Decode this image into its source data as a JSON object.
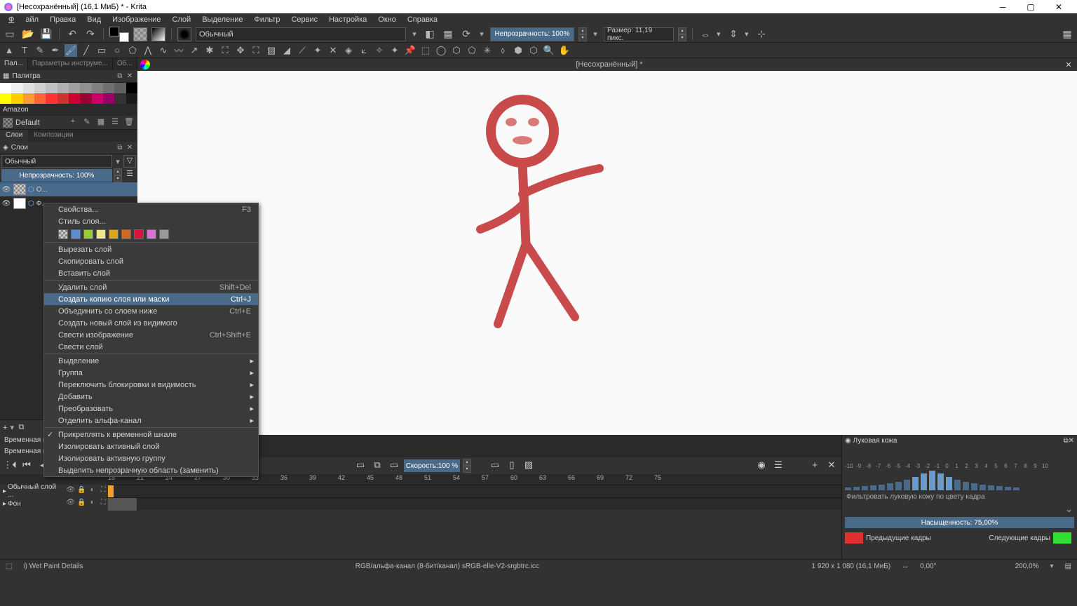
{
  "titlebar": {
    "text": "[Несохранённый] (16,1 МиБ) * - Krita"
  },
  "menu": {
    "file": "Файл",
    "edit": "Правка",
    "view": "Вид",
    "image": "Изображение",
    "layer": "Слой",
    "select": "Выделение",
    "filter": "Фильтр",
    "service": "Сервис",
    "settings": "Настройка",
    "window": "Окно",
    "help": "Справка"
  },
  "toolbar": {
    "blend_mode": "Обычный",
    "opacity": "Непрозрачность: 100%",
    "size": "Размер: 11,19 пикс."
  },
  "left": {
    "tabs": {
      "pal": "Пал...",
      "params": "Параметры инструме...",
      "overview": "Об..."
    },
    "palette_title": "Палитра",
    "palette_colors_row1": [
      "#ffffff",
      "#f0f0f0",
      "#e0e0e0",
      "#d0d0d0",
      "#c0c0c0",
      "#b0b0b0",
      "#a0a0a0",
      "#909090",
      "#808080",
      "#707070",
      "#606060",
      "#000000"
    ],
    "palette_colors_row2": [
      "#ffff00",
      "#ffcc00",
      "#ff9933",
      "#ff6633",
      "#ff3333",
      "#cc3333",
      "#cc0033",
      "#990033",
      "#cc0066",
      "#990066",
      "#333333",
      "#1a1a1a"
    ],
    "palette_name": "Amazon",
    "palette_default": "Default",
    "layer_tabs": {
      "layers": "Слои",
      "comps": "Композиции"
    },
    "layers_title": "Слои",
    "layer_mode": "Обычный",
    "layer_opacity": "Непрозрачность: 100%",
    "layer1": "О...",
    "layer2": "Ф..."
  },
  "canvas": {
    "doc_title": "[Несохранённый] *"
  },
  "context_menu": {
    "properties": "Свойства...",
    "properties_sc": "F3",
    "layer_style": "Стиль слоя...",
    "colors": [
      "#5a8fd0",
      "#9acd32",
      "#f0e68c",
      "#daa520",
      "#d2691e",
      "#dc143c",
      "#da70d6",
      "#999999"
    ],
    "cut": "Вырезать слой",
    "copy": "Скопировать слой",
    "paste": "Вставить слой",
    "delete": "Удалить слой",
    "delete_sc": "Shift+Del",
    "duplicate": "Создать копию слоя или маски",
    "duplicate_sc": "Ctrl+J",
    "merge_down": "Объединить со слоем ниже",
    "merge_down_sc": "Ctrl+E",
    "new_from_visible": "Создать новый слой из видимого",
    "flatten_image": "Свести изображение",
    "flatten_image_sc": "Ctrl+Shift+E",
    "flatten_layer": "Свести слой",
    "selection": "Выделение",
    "group": "Группа",
    "toggle_locks": "Переключить блокировки и видимость",
    "add": "Добавить",
    "transform": "Преобразовать",
    "split_alpha": "Отделить альфа-канал",
    "pin_timeline": "Прикреплять к временной шкале",
    "isolate_layer": "Изолировать активный слой",
    "isolate_group": "Изолировать активную группу",
    "select_opaque": "Выделить непрозрачную область (заменить)"
  },
  "timeline": {
    "tab1": "Временная ш",
    "tab2": "Временная ш",
    "speed": "Скорость:100 %",
    "frames": [
      "18",
      "21",
      "24",
      "27",
      "30",
      "33",
      "36",
      "39",
      "42",
      "45",
      "48",
      "51",
      "54",
      "57",
      "60",
      "63",
      "66",
      "69",
      "72",
      "75"
    ],
    "track1": "Обычный слой ...",
    "track2": "Фон"
  },
  "onion": {
    "title": "Луковая кожа",
    "ticks": [
      "-10",
      "-9",
      "-8",
      "-7",
      "-6",
      "-5",
      "-4",
      "-3",
      "-2",
      "-1",
      "0",
      "1",
      "2",
      "3",
      "4",
      "5",
      "6",
      "7",
      "8",
      "9",
      "10"
    ],
    "filter": "Фильтровать луковую кожу по цвету кадра",
    "saturation": "Насыщенность: 75,00%",
    "prev": "Предыдущие кадры",
    "next": "Следующие кадры"
  },
  "status": {
    "brush": "i) Wet Paint Details",
    "colorspace": "RGB/альфа-канал (8-бит/канал)  sRGB-elle-V2-srgbtrc.icc",
    "dims": "1 920 x 1 080 (16,1 МиБ)",
    "angle": "0,00°",
    "zoom": "200,0%"
  }
}
